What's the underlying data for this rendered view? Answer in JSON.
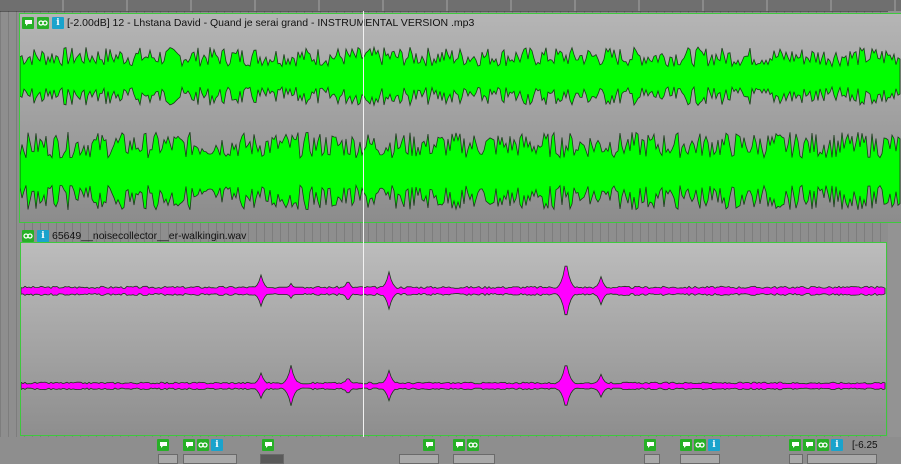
{
  "tracks": [
    {
      "item_label": "[-2.00dB] 12 - Lhstana David - Quand je serai grand - INSTRUMENTAL VERSION .mp3",
      "wave_color": "#00ff00",
      "icons": [
        "comment-icon",
        "link-icon",
        "info-icon"
      ]
    },
    {
      "item_label": "65649__noisecollector__er-walkingin.wav",
      "wave_color": "#ff00ff",
      "icons": [
        "link-icon",
        "info-icon"
      ]
    }
  ],
  "bottom": {
    "truncated_label": "[-6.25"
  },
  "colors": {
    "item_border": "#3ec83e",
    "cursor": "#f2f2f2",
    "background": "#8e8e8e"
  }
}
